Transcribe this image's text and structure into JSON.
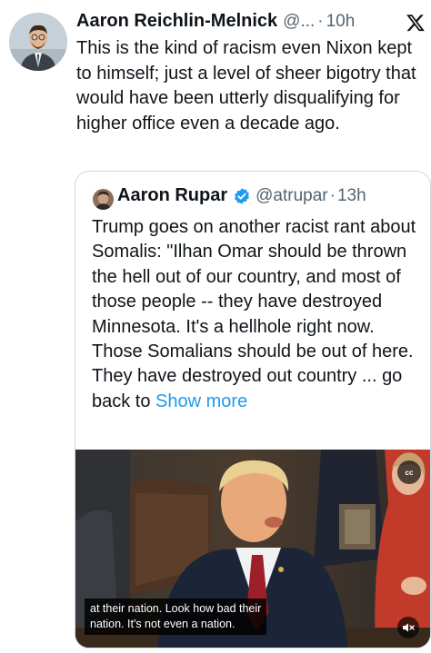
{
  "tweet": {
    "author_name": "Aaron Reichlin-Melnick",
    "author_handle": "@...",
    "separator": "·",
    "time": "10h",
    "text": "This is the kind of racism even Nixon kept to himself; just a level of sheer bigotry that would have been utterly disqualifying for higher office even a decade ago."
  },
  "quoted": {
    "author_name": "Aaron Rupar",
    "author_handle": "@atrupar",
    "separator": "·",
    "time": "13h",
    "text": "Trump goes on another racist rant about Somalis: \"Ilhan Omar should be thrown the hell out of our country, and most of those people -- they have destroyed Minnesota. It's a hellhole right now. Those Somalians should be out of here. They have destroyed out country ... go back to ",
    "show_more": "Show more",
    "verified": true
  },
  "video": {
    "caption_line1": "at their nation. Look how bad their",
    "caption_line2": "nation. It's not even a nation.",
    "cc_label": "cc"
  },
  "icons": {
    "platform": "x-logo-icon",
    "verified": "verified-badge-icon",
    "mute": "mute-icon",
    "captions": "closed-captions-icon"
  },
  "colors": {
    "link": "#1d9bf0",
    "secondary_text": "#536471",
    "border": "#cfd9de"
  }
}
